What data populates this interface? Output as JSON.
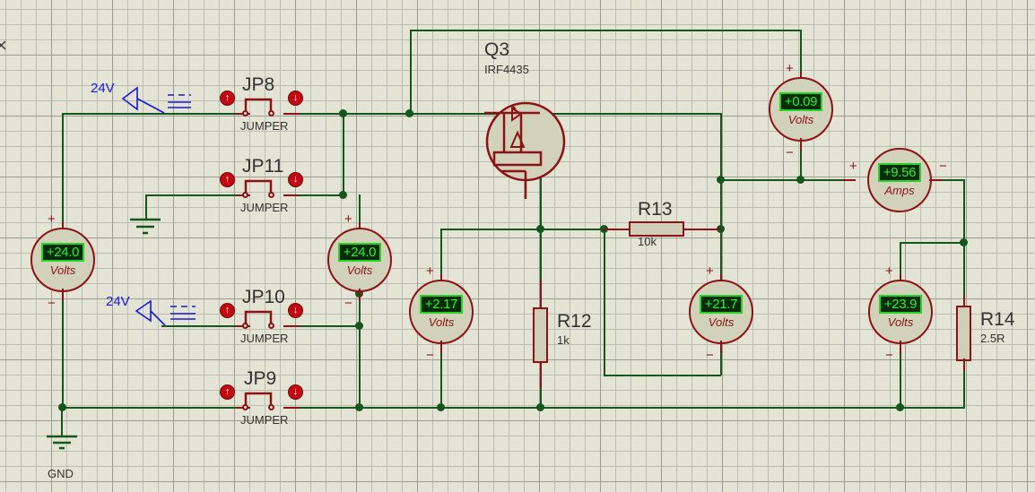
{
  "app": {
    "type": "circuit-schematic-simulation"
  },
  "colors": {
    "background": "#e3e4d4",
    "wire": "#14561b",
    "component": "#8b1216",
    "lcd_bg": "#062b06",
    "lcd_text": "#2ef02e",
    "probe_label": "#1818d8",
    "text": "#333333"
  },
  "meters": [
    {
      "name": "supply-voltmeter-left",
      "value": "+24.0",
      "unit": "Volts",
      "orientation": "vertical",
      "plus": "+",
      "minus": "−"
    },
    {
      "name": "supply-voltmeter-mid",
      "value": "+24.0",
      "unit": "Volts",
      "orientation": "vertical",
      "plus": "+",
      "minus": "−"
    },
    {
      "name": "gate-voltmeter",
      "value": "+2.17",
      "unit": "Volts",
      "orientation": "vertical",
      "plus": "+",
      "minus": "−"
    },
    {
      "name": "vds-voltmeter",
      "value": "+0.09",
      "unit": "Volts",
      "orientation": "vertical",
      "plus": "+",
      "minus": "−"
    },
    {
      "name": "r13-voltmeter",
      "value": "+21.7",
      "unit": "Volts",
      "orientation": "vertical",
      "plus": "+",
      "minus": "−"
    },
    {
      "name": "load-voltmeter",
      "value": "+23.9",
      "unit": "Volts",
      "orientation": "vertical",
      "plus": "+",
      "minus": "−"
    },
    {
      "name": "load-ammeter",
      "value": "+9.56",
      "unit": "Amps",
      "orientation": "horizontal",
      "plus": "+",
      "minus": "−"
    }
  ],
  "transistor": {
    "ref": "Q3",
    "part": "IRF4435"
  },
  "resistors": [
    {
      "ref": "R12",
      "value": "1k",
      "orientation": "vertical"
    },
    {
      "ref": "R13",
      "value": "10k",
      "orientation": "horizontal"
    },
    {
      "ref": "R14",
      "value": "2.5R",
      "orientation": "vertical"
    }
  ],
  "jumpers": [
    {
      "ref": "JP8",
      "type": "JUMPER",
      "up": "↑",
      "down": "↓",
      "state": "closed"
    },
    {
      "ref": "JP11",
      "type": "JUMPER",
      "up": "↑",
      "down": "↓",
      "state": "closed"
    },
    {
      "ref": "JP10",
      "type": "JUMPER",
      "up": "↑",
      "down": "↓",
      "state": "closed"
    },
    {
      "ref": "JP9",
      "type": "JUMPER",
      "up": "↑",
      "down": "↓",
      "state": "closed"
    }
  ],
  "probes": [
    {
      "name": "probe-24v-top",
      "label": "24V"
    },
    {
      "name": "probe-24v-bottom",
      "label": "24V"
    }
  ],
  "terminals": [
    {
      "name": "ground-terminal",
      "label": "GND"
    }
  ]
}
